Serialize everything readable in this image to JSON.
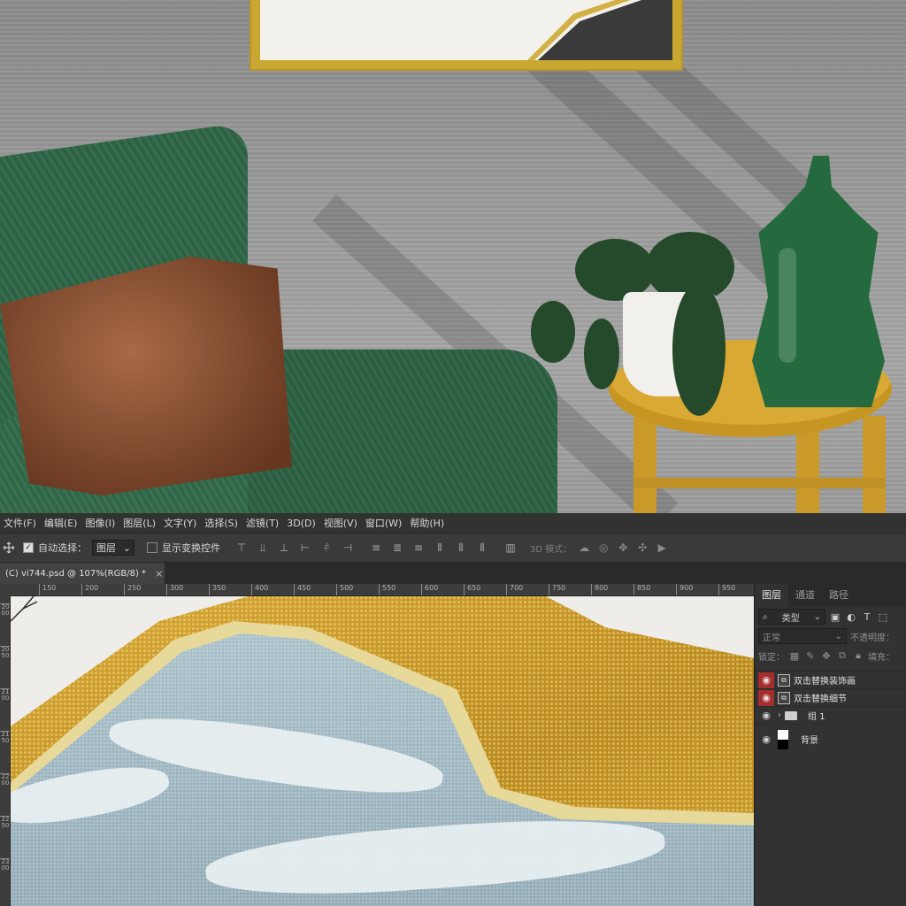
{
  "menubar": {
    "items": [
      "文件(F)",
      "编辑(E)",
      "图像(I)",
      "图层(L)",
      "文字(Y)",
      "选择(S)",
      "滤镜(T)",
      "3D(D)",
      "视图(V)",
      "窗口(W)",
      "帮助(H)"
    ]
  },
  "options": {
    "tool_icon": "move-tool-icon",
    "auto_select_label": "自动选择：",
    "auto_select_checked": true,
    "auto_select_target": "图层",
    "show_transform_label": "显示变换控件",
    "show_transform_checked": false,
    "mode_3d_label": "3D 模式："
  },
  "document_tab": {
    "title": "(C) vi744.psd @ 107%(RGB/8) *",
    "close": "×"
  },
  "ruler": {
    "horizontal_ticks": [
      "150",
      "200",
      "250",
      "300",
      "350",
      "400",
      "450",
      "500",
      "550",
      "600",
      "650",
      "700",
      "750",
      "800",
      "850",
      "900",
      "950"
    ],
    "vertical_ticks": [
      "2000",
      "2050",
      "2100",
      "2150",
      "2200",
      "2250",
      "2300"
    ]
  },
  "layers_panel": {
    "tabs": [
      "图层",
      "通道",
      "路径"
    ],
    "active_tab": "图层",
    "filter_kind": "类型",
    "blend_mode": "正常",
    "opacity_label": "不透明度：",
    "lock_label": "锁定：",
    "fill_label": "填充：",
    "layers": [
      {
        "name": "双击替换装饰画",
        "type": "smart-object",
        "visible": true,
        "highlighted": true
      },
      {
        "name": "双击替换细节",
        "type": "smart-object",
        "visible": true,
        "highlighted": true
      },
      {
        "name": "组 1",
        "type": "group",
        "visible": true,
        "highlighted": false
      },
      {
        "name": "背景",
        "type": "background",
        "visible": true,
        "highlighted": false
      }
    ]
  },
  "colors": {
    "ps_panel": "#323232",
    "ps_bar": "#3a3a3a",
    "eye_highlight": "#a32e2e",
    "gold": "#c9982a",
    "blue": "#9fb8c2"
  }
}
